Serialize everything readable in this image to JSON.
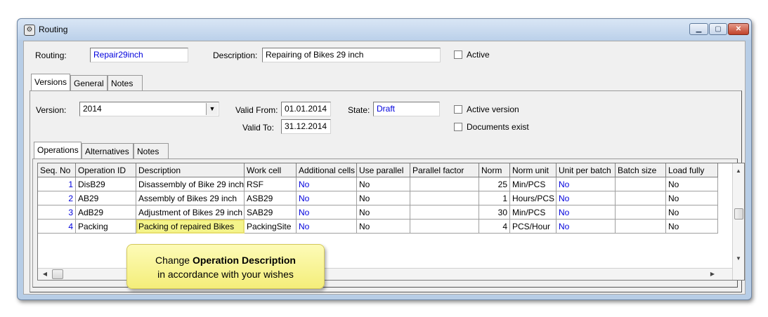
{
  "window": {
    "title": "Routing"
  },
  "header": {
    "routing_label": "Routing:",
    "routing_value": "Repair29inch",
    "description_label": "Description:",
    "description_value": "Repairing of Bikes 29 inch",
    "active_label": "Active"
  },
  "tabs_top": [
    "Versions",
    "General",
    "Notes"
  ],
  "version": {
    "version_label": "Version:",
    "version_value": "2014",
    "valid_from_label": "Valid From:",
    "valid_from_value": "01.01.2014",
    "valid_to_label": "Valid To:",
    "valid_to_value": "31.12.2014",
    "state_label": "State:",
    "state_value": "Draft",
    "active_version_label": "Active version",
    "documents_exist_label": "Documents exist"
  },
  "tabs_inner": [
    "Operations",
    "Alternatives",
    "Notes"
  ],
  "table": {
    "columns": [
      "Seq. No",
      "Operation ID",
      "Description",
      "Work cell",
      "Additional cells",
      "Use parallel",
      "Parallel factor",
      "Norm",
      "Norm unit",
      "Unit per batch",
      "Batch size",
      "Load fully"
    ],
    "rows": [
      [
        "1",
        "DisB29",
        "Disassembly of Bike 29 inch",
        "RSF",
        "No",
        "No",
        "",
        "25",
        "Min/PCS",
        "No",
        "",
        "No"
      ],
      [
        "2",
        "AB29",
        "Assembly of Bikes 29 inch",
        "ASB29",
        "No",
        "No",
        "",
        "1",
        "Hours/PCS",
        "No",
        "",
        "No"
      ],
      [
        "3",
        "AdB29",
        "Adjustment of Bikes 29 inch",
        "SAB29",
        "No",
        "No",
        "",
        "30",
        "Min/PCS",
        "No",
        "",
        "No"
      ],
      [
        "4",
        "Packing",
        "Packing of repaired Bikes",
        "PackingSite",
        "No",
        "No",
        "",
        "4",
        "PCS/Hour",
        "No",
        "",
        "No"
      ]
    ]
  },
  "callout": {
    "line1_pre": "Change ",
    "line1_bold": "Operation Description",
    "line2": "in accordance with your wishes"
  },
  "colors": {
    "link_blue": "#0000dd",
    "callout_yellow": "#f4ee7a",
    "highlight": "#f4f48a"
  }
}
